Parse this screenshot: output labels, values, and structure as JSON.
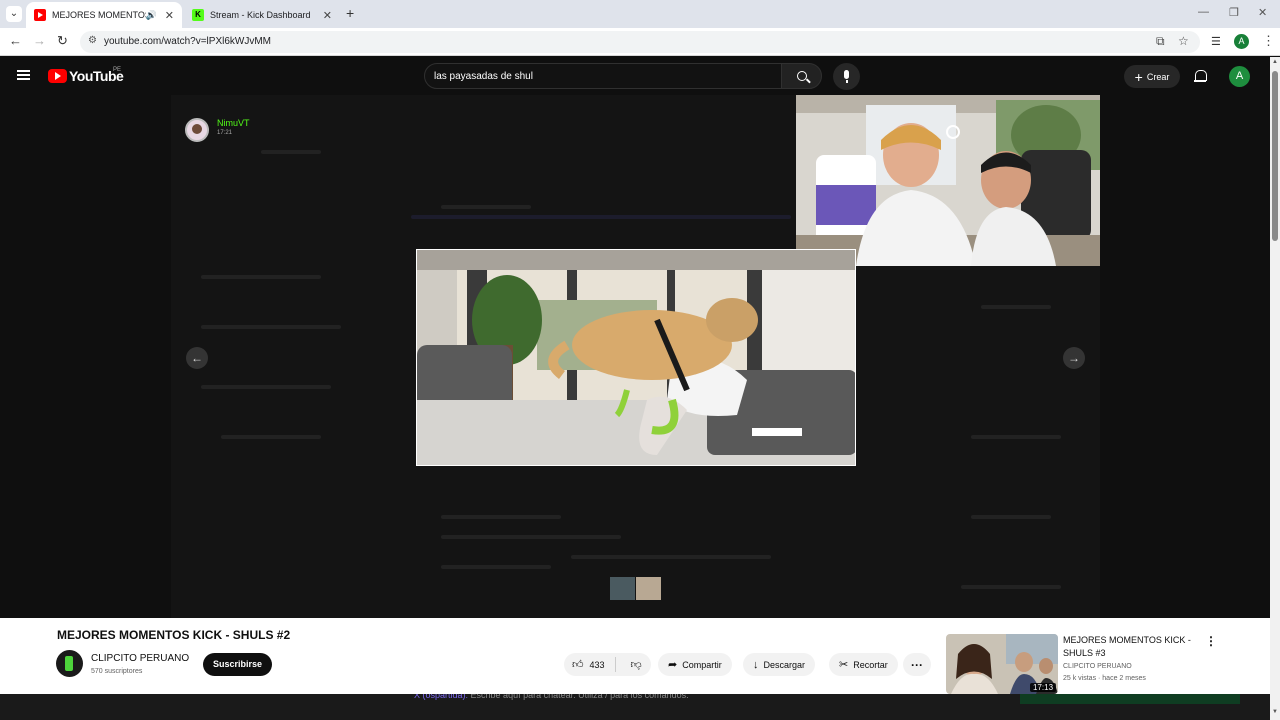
{
  "browser": {
    "tabs": [
      {
        "label": "MEJORES MOMENTOS KICK",
        "active": true,
        "favicon": "youtube-icon",
        "audio": true
      },
      {
        "label": "Stream - Kick Dashboard",
        "active": false,
        "favicon": "kick-icon"
      }
    ],
    "url": "youtube.com/watch?v=lPXl6kWJvMM"
  },
  "youtube": {
    "logo_text": "YouTube",
    "country": "PE",
    "search_value": "las payasadas de shul",
    "create_label": "Crear",
    "account_initial": "A"
  },
  "player": {
    "streamer_name": "NimuVT",
    "streamer_time": "17:21"
  },
  "video": {
    "title": "MEJORES MOMENTOS KICK - SHULS #2",
    "channel_name": "CLIPCITO PERUANO",
    "subscribers": "570 suscriptores",
    "subscribe_label": "Suscribirse",
    "likes": "433",
    "share_label": "Compartir",
    "download_label": "Descargar",
    "clip_label": "Recortar"
  },
  "recommended": {
    "title": "MEJORES MOMENTOS KICK - SHULS #3",
    "channel": "CLIPCITO PERUANO",
    "meta": "25 k vistas · hace 2 meses",
    "duration": "17:13"
  },
  "background_chat": {
    "user": "X (ospartida):",
    "text": "Escribe aquí para chatear. Utiliza / para los comandos."
  },
  "colors": {
    "youtube_red": "#ff0000",
    "kick_green": "#53fc18",
    "dark_bg": "#0f0f0f"
  }
}
